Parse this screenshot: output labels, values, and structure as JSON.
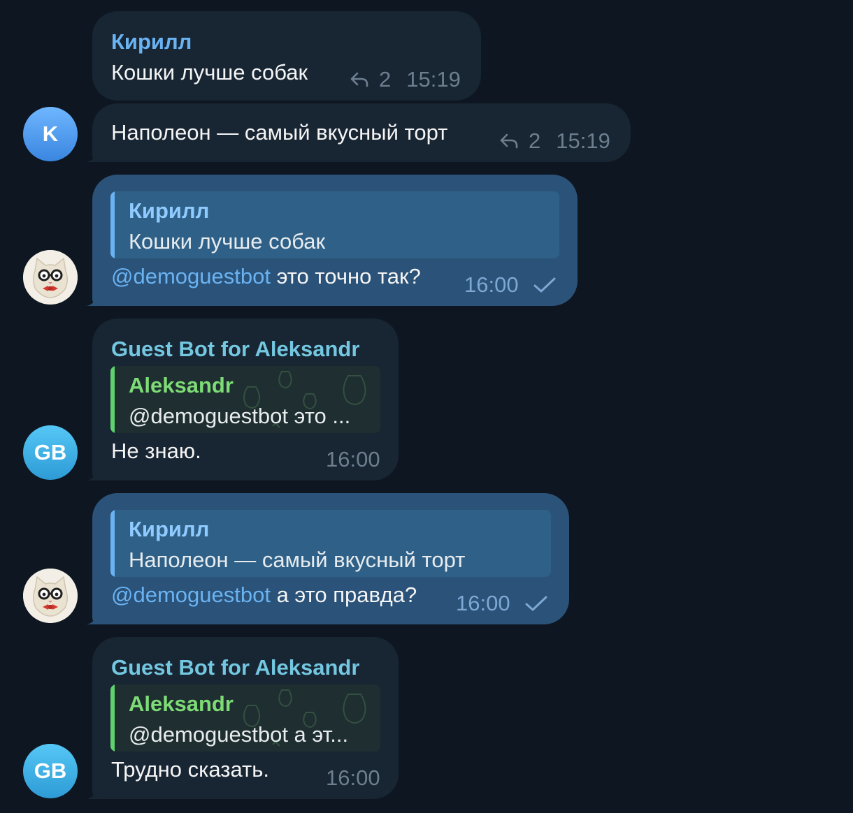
{
  "messages": [
    {
      "sender": "Кирилл",
      "text": "Кошки лучше собак",
      "replies": "2",
      "time": "15:19"
    },
    {
      "avatar_letter": "K",
      "text": "Наполеон — самый вкусный торт",
      "replies": "2",
      "time": "15:19"
    },
    {
      "quote_name": "Кирилл",
      "quote_text": "Кошки лучше собак",
      "mention": "@demoguestbot",
      "text": " это точно так?",
      "time": "16:00"
    },
    {
      "sender": "Guest Bot for Aleksandr",
      "avatar_letters": "GB",
      "quote_name": "Aleksandr",
      "quote_text": "@demoguestbot это ...",
      "text": "Не знаю.",
      "time": "16:00"
    },
    {
      "quote_name": "Кирилл",
      "quote_text": "Наполеон — самый вкусный торт",
      "mention": "@demoguestbot",
      "text": " а это правда?",
      "time": "16:00"
    },
    {
      "sender": "Guest Bot for Aleksandr",
      "avatar_letters": "GB",
      "quote_name": "Aleksandr",
      "quote_text": "@demoguestbot а эт...",
      "text": "Трудно сказать.",
      "time": "16:00"
    }
  ],
  "colors": {
    "background": "#0e1621",
    "incoming_bubble": "#182533",
    "outgoing_bubble": "#2b5278",
    "name_blue": "#6ab3f3",
    "name_green": "#7ddc75"
  },
  "icons": {
    "reply": "reply-arrow-icon",
    "read": "checkmark-icon",
    "avatar_cat": "cat-with-glasses-avatar"
  }
}
